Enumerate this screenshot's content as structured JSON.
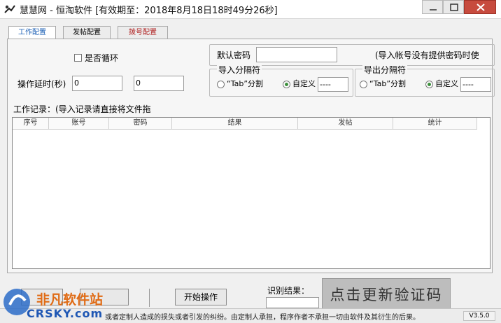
{
  "window": {
    "title": "慧慧网 - 恒淘软件 [有效期至：2018年8月18日18时49分26秒]"
  },
  "tabs": [
    {
      "label": "工作配置"
    },
    {
      "label": "发帖配置"
    },
    {
      "label": "拨号配置"
    }
  ],
  "work_config": {
    "loop_checkbox_label": "是否循环",
    "delay_label": "操作延时(秒)",
    "delay_from": "0",
    "delay_to": "0",
    "default_password_label": "默认密码",
    "default_password_value": "",
    "default_password_hint": "(导入帐号没有提供密码时使",
    "import_sep": {
      "group_label": "导入分隔符",
      "tab_option": "“Tab”分割",
      "custom_option": "自定义",
      "custom_value": "----"
    },
    "export_sep": {
      "group_label": "导出分隔符",
      "tab_option": "“Tab”分割",
      "custom_option": "自定义",
      "custom_value": "----"
    },
    "work_log_label": "工作记录：(导入记录请直接将文件拖",
    "table_columns": [
      "序号",
      "账号",
      "密码",
      "结果",
      "发帖",
      "统计"
    ]
  },
  "bottom": {
    "start_button": "开始操作",
    "recognize_label": "识别结果：",
    "recognize_value": "",
    "captcha_label": "点击更新验证码",
    "status_text": "或者定制人造成的损失或者引发的纠纷。由定制人承担，程序作者不承担一切由软件及其衍生的后果。",
    "version": "V3.5.0"
  },
  "watermark": {
    "text": "非凡软件站",
    "sub": "CRSKY.com"
  },
  "colors": {
    "accent_tab": "#1b5fb5",
    "captcha_bg": "#bdbdbd",
    "close_button": "#c74b3e"
  }
}
